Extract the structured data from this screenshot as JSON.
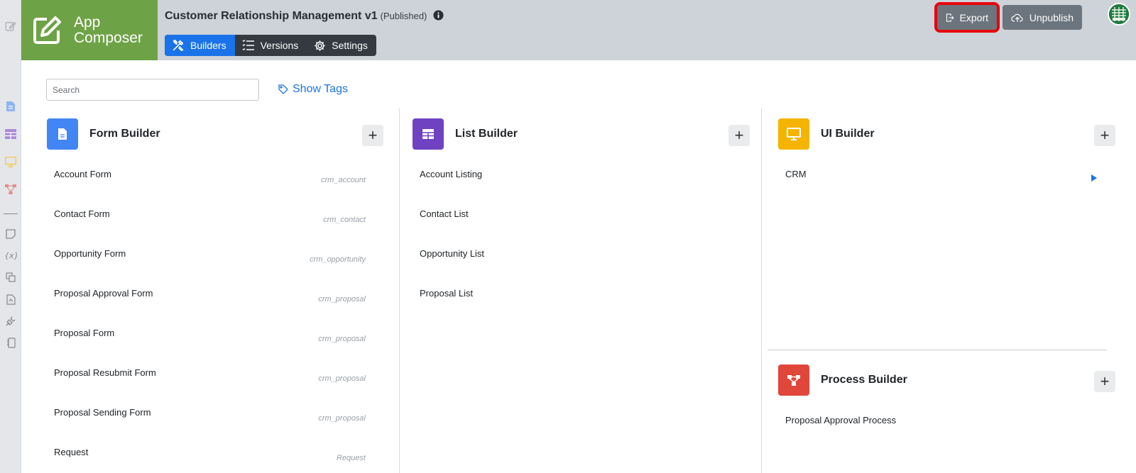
{
  "brand": {
    "line1": "App",
    "line2": "Composer"
  },
  "header": {
    "title": "Customer Relationship Management v1",
    "status": "(Published)",
    "tabs": [
      {
        "label": "Builders",
        "icon": "builders-icon",
        "active": true
      },
      {
        "label": "Versions",
        "icon": "list-icon",
        "active": false
      },
      {
        "label": "Settings",
        "icon": "gear-icon",
        "active": false
      }
    ],
    "export_label": "Export",
    "unpublish_label": "Unpublish"
  },
  "search": {
    "placeholder": "Search",
    "value": ""
  },
  "show_tags_label": "Show Tags",
  "form_builder": {
    "title": "Form Builder",
    "color": "#4285f4",
    "items": [
      {
        "name": "Account Form",
        "tag": "crm_account"
      },
      {
        "name": "Contact Form",
        "tag": "crm_contact"
      },
      {
        "name": "Opportunity Form",
        "tag": "crm_opportunity"
      },
      {
        "name": "Proposal Approval Form",
        "tag": "crm_proposal"
      },
      {
        "name": "Proposal Form",
        "tag": "crm_proposal"
      },
      {
        "name": "Proposal Resubmit Form",
        "tag": "crm_proposal"
      },
      {
        "name": "Proposal Sending Form",
        "tag": "crm_proposal"
      },
      {
        "name": "Request",
        "tag": "Request"
      }
    ]
  },
  "list_builder": {
    "title": "List Builder",
    "color": "#6f42c1",
    "items": [
      {
        "name": "Account Listing"
      },
      {
        "name": "Contact List"
      },
      {
        "name": "Opportunity List"
      },
      {
        "name": "Proposal List"
      }
    ]
  },
  "ui_builder": {
    "title": "UI Builder",
    "color": "#f4b400",
    "items": [
      {
        "name": "CRM"
      }
    ]
  },
  "process_builder": {
    "title": "Process Builder",
    "color": "#e0463a",
    "items": [
      {
        "name": "Proposal Approval Process"
      }
    ]
  },
  "colors": {
    "header_bg": "#cdd3d9",
    "brand_bg": "#6ea246",
    "accent": "#1a73e8",
    "highlight": "#e8000b"
  }
}
